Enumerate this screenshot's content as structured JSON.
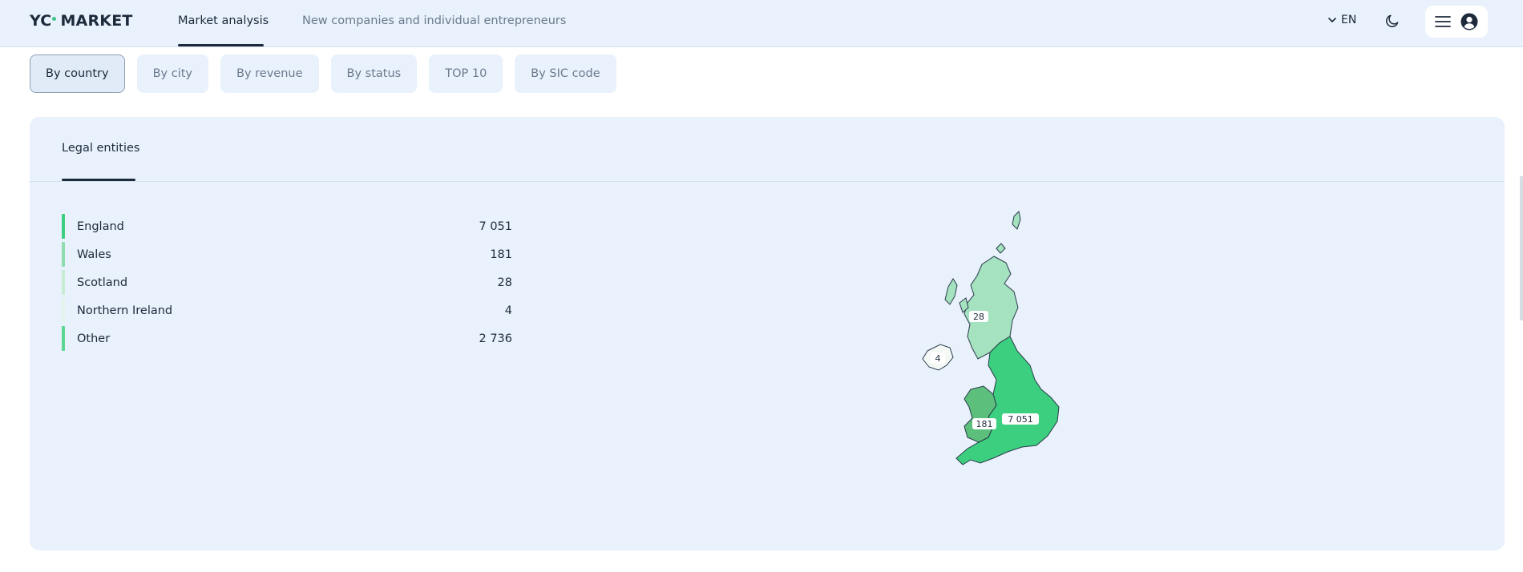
{
  "header": {
    "logo_left": "YC",
    "logo_right": "MARKET",
    "nav": [
      {
        "label": "Market analysis",
        "active": true
      },
      {
        "label": "New companies and individual entrepreneurs",
        "active": false
      }
    ],
    "language": "EN",
    "icons": [
      "chevron-down-icon",
      "moon-icon",
      "hamburger-menu-icon",
      "user-avatar-icon"
    ]
  },
  "filters": [
    {
      "label": "By country",
      "active": true
    },
    {
      "label": "By city",
      "active": false
    },
    {
      "label": "By revenue",
      "active": false
    },
    {
      "label": "By status",
      "active": false
    },
    {
      "label": "TOP 10",
      "active": false
    },
    {
      "label": "By SIC code",
      "active": false
    }
  ],
  "panel": {
    "tab_label": "Legal entities",
    "rows": [
      {
        "name": "England",
        "count": "7 051",
        "color": "#3ccf7f"
      },
      {
        "name": "Wales",
        "count": "181",
        "color": "#8fdcae"
      },
      {
        "name": "Scotland",
        "count": "28",
        "color": "#c6ecd4"
      },
      {
        "name": "Northern Ireland",
        "count": "4",
        "color": "#e3f5ea"
      },
      {
        "name": "Other",
        "count": "2 736",
        "color": "#5cd690"
      }
    ],
    "map_labels": {
      "scotland": "28",
      "northern_ireland": "4",
      "wales": "181",
      "england": "7 051"
    },
    "map_colors": {
      "england": "#3ccf7f",
      "wales": "#5cbf7c",
      "scotland": "#a5e2bf",
      "northern_ireland": "#f4f9f6"
    }
  }
}
